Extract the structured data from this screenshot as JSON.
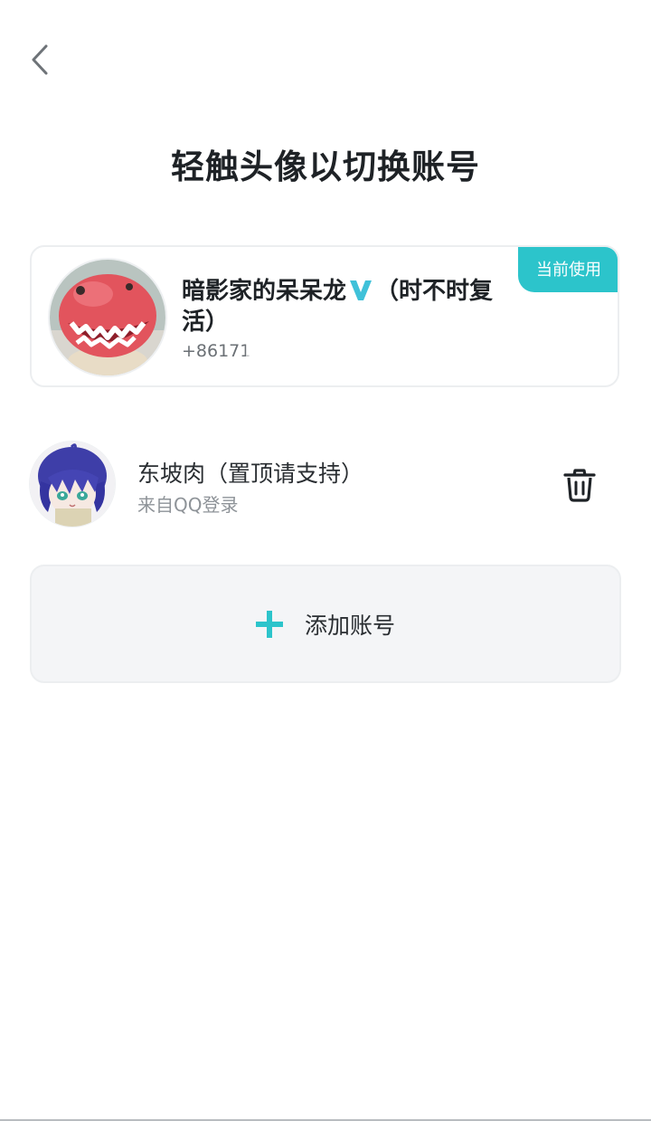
{
  "nav": {
    "back_icon": "chevron-left-icon"
  },
  "header": {
    "title": "轻触头像以切换账号"
  },
  "current_account": {
    "badge": "当前使用",
    "name_part1": "暗影家的呆呆龙",
    "verified_icon": "v-verified-icon",
    "name_part2": "（时不时复活）",
    "phone": "+86171",
    "avatar_icon": "red-dinosaur-avatar"
  },
  "accounts": [
    {
      "name": "东坡肉（置顶请支持）",
      "source": "来自QQ登录",
      "avatar_icon": "anime-avatar",
      "action_icon": "trash-icon"
    }
  ],
  "add_account": {
    "label": "添加账号",
    "icon": "plus-icon"
  },
  "colors": {
    "accent": "#2cc4cb",
    "title_text": "#1e2226",
    "secondary_text": "#8e9398",
    "card_border": "#eceef0",
    "add_bg": "#f4f5f7"
  }
}
